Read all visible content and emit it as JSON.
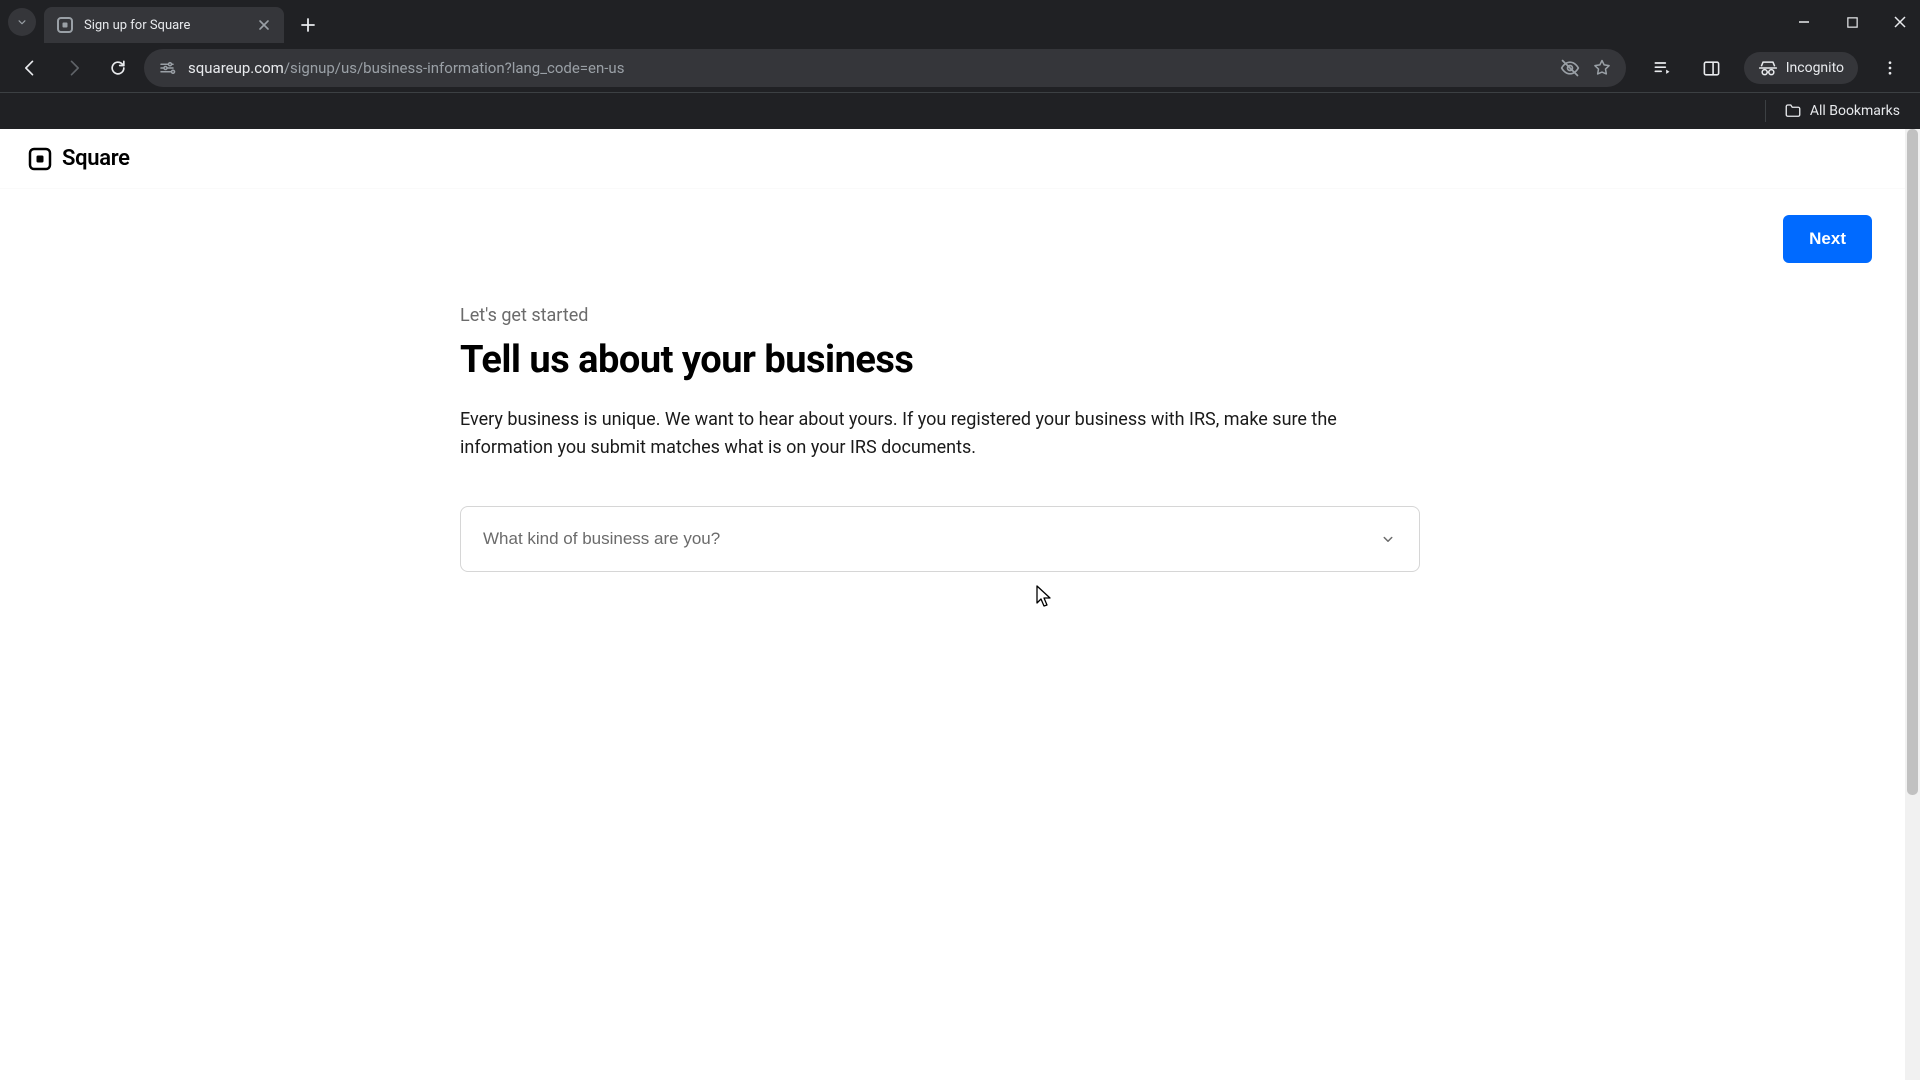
{
  "browser": {
    "tab_title": "Sign up for Square",
    "url_domain": "squareup.com",
    "url_path": "/signup/us/business-information?lang_code=en-us",
    "incognito_label": "Incognito",
    "all_bookmarks_label": "All Bookmarks"
  },
  "header": {
    "brand": "Square"
  },
  "actions": {
    "next_label": "Next"
  },
  "main": {
    "kicker": "Let's get started",
    "headline": "Tell us about your business",
    "description": "Every business is unique. We want to hear about yours. If you registered your business with IRS, make sure the information you submit matches what is on your IRS documents.",
    "business_type_placeholder": "What kind of business are you?"
  }
}
